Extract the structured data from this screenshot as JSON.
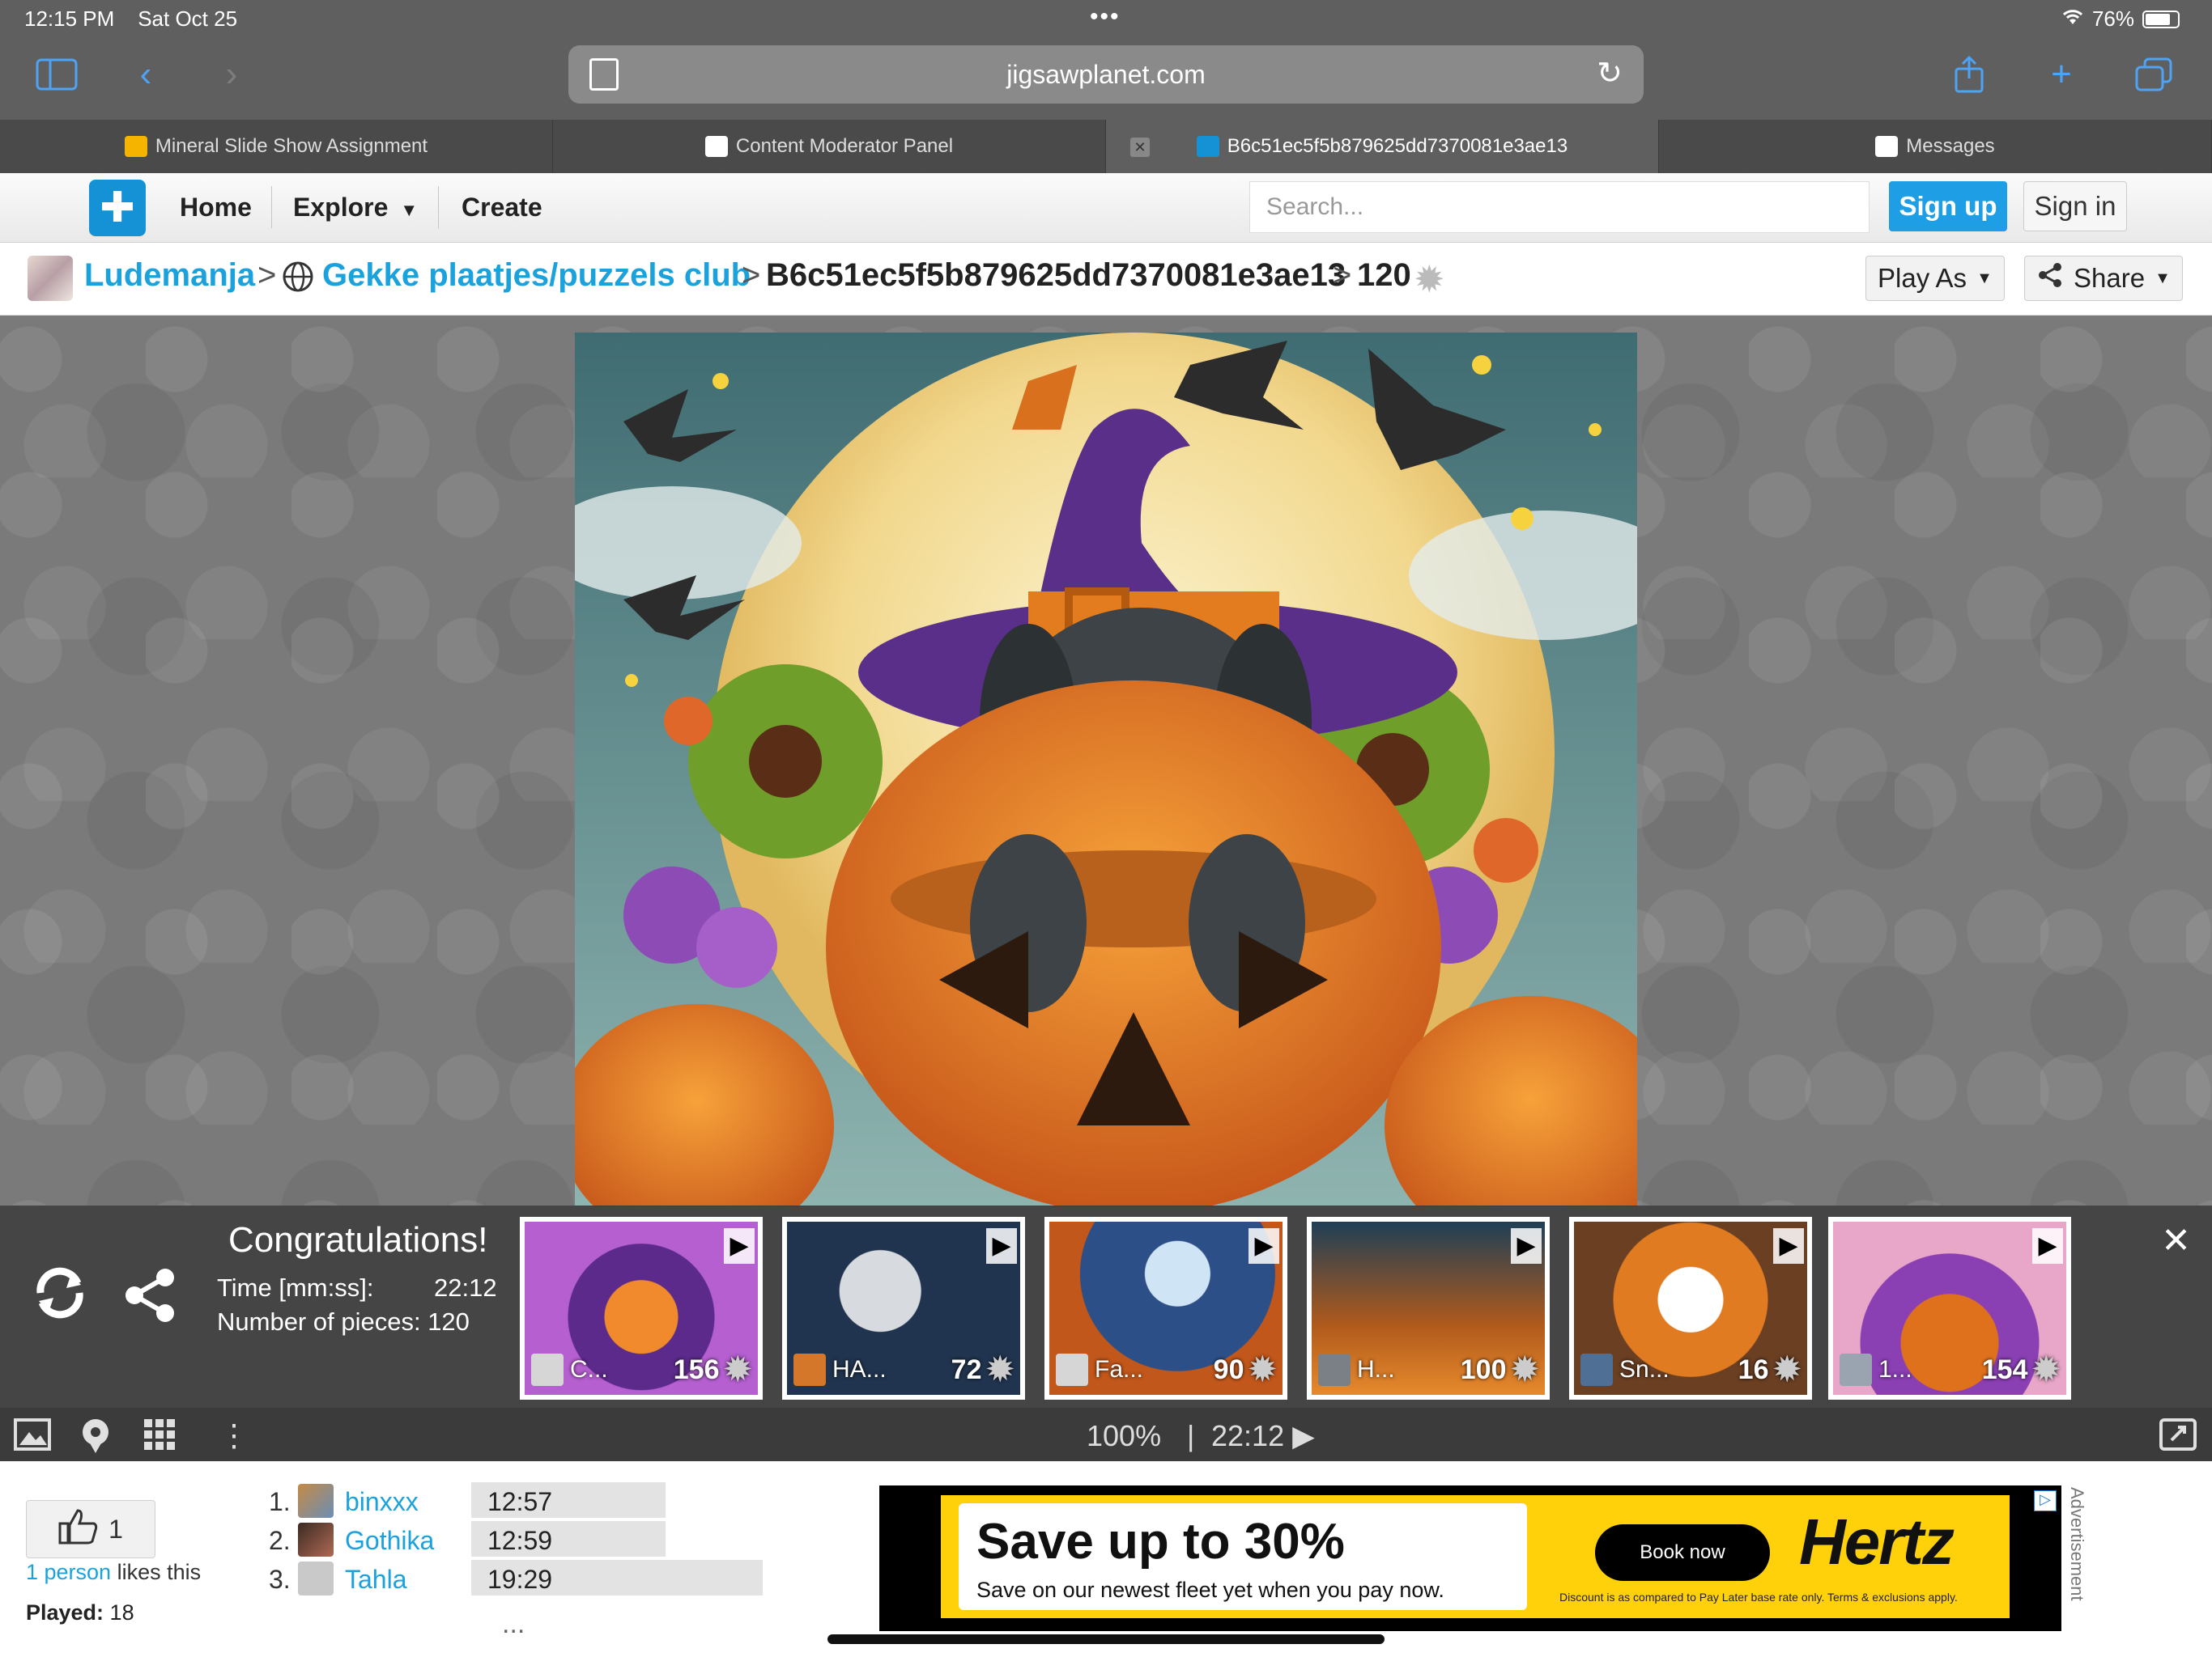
{
  "status_bar": {
    "time": "12:15 PM",
    "date": "Sat Oct 25",
    "battery": "76%"
  },
  "browser": {
    "url": "jigsawplanet.com"
  },
  "tabs": [
    {
      "label": "Mineral Slide Show Assignment",
      "icon": "slides-icon",
      "color": "#f4b400"
    },
    {
      "label": "Content Moderator Panel",
      "icon": "dog-icon",
      "color": "#ffffff"
    },
    {
      "label": "B6c51ec5f5b879625dd7370081e3ae13",
      "icon": "puzzle-icon",
      "color": "#1592d6"
    },
    {
      "label": "Messages",
      "icon": "dog-icon",
      "color": "#ffffff"
    }
  ],
  "sitenav": {
    "home": "Home",
    "explore": "Explore",
    "create": "Create",
    "search_placeholder": "Search...",
    "signup": "Sign up",
    "signin": "Sign in"
  },
  "breadcrumb": {
    "user": "Ludemanja",
    "club": "Gekke plaatjes/puzzels club",
    "puzzle": "B6c51ec5f5b879625dd7370081e3ae13",
    "pieces": "120",
    "play_as": "Play As",
    "share": "Share"
  },
  "congrats": {
    "title": "Congratulations!",
    "time_label": "Time [mm:ss]:",
    "time_value": "22:12",
    "pieces_label": "Number of pieces:",
    "pieces_value": "120"
  },
  "suggestions": [
    {
      "name": "C...",
      "pieces": "156"
    },
    {
      "name": "HA...",
      "pieces": "72"
    },
    {
      "name": "Fa...",
      "pieces": "90"
    },
    {
      "name": "H...",
      "pieces": "100"
    },
    {
      "name": "Sn...",
      "pieces": "16"
    },
    {
      "name": "1...",
      "pieces": "154"
    }
  ],
  "toolbar": {
    "zoom": "100%",
    "divider": "|",
    "timer": "22:12 ▶"
  },
  "likes": {
    "count": "1",
    "person_link": "1 person",
    "likes_text": " likes this",
    "played_label": "Played:",
    "played_value": " 18"
  },
  "leaderboard": [
    {
      "rank": "1.",
      "name": "binxxx",
      "time": "12:57"
    },
    {
      "rank": "2.",
      "name": "Gothika",
      "time": "12:59"
    },
    {
      "rank": "3.",
      "name": "Tahla",
      "time": "19:29"
    }
  ],
  "leaderboard_more": "...",
  "ad": {
    "headline": "Save up to 30%",
    "subline": "Save on our newest fleet yet when you pay now.",
    "cta": "Book now",
    "brand": "Hertz",
    "fine_print": "Discount is as compared to Pay Later base rate only. Terms & exclusions apply.",
    "label": "Advertisement"
  }
}
